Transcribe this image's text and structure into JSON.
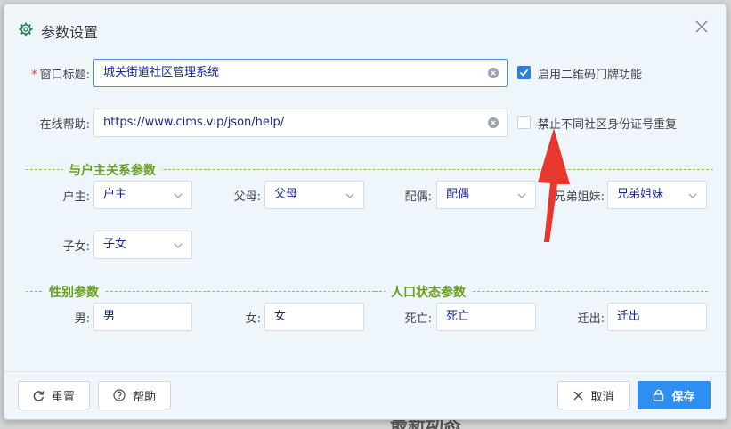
{
  "dialog": {
    "title": "参数设置",
    "window_title": {
      "label": "窗口标题:",
      "value": "城关街道社区管理系统"
    },
    "help": {
      "label": "在线帮助:",
      "value": "https://www.cims.vip/json/help/"
    },
    "options": [
      {
        "label": "启用二维码门牌功能",
        "checked": true
      },
      {
        "label": "禁止不同社区身份证号重复",
        "checked": false
      }
    ],
    "sections": {
      "relation": "与户主关系参数",
      "gender": "性别参数",
      "status": "人口状态参数"
    },
    "relation_fields": [
      {
        "label": "户主:",
        "value": "户主"
      },
      {
        "label": "父母:",
        "value": "父母"
      },
      {
        "label": "配偶:",
        "value": "配偶"
      },
      {
        "label": "兄弟姐妹:",
        "value": "兄弟姐妹"
      },
      {
        "label": "子女:",
        "value": "子女"
      }
    ],
    "gender_fields": [
      {
        "label": "男:",
        "value": "男"
      },
      {
        "label": "女:",
        "value": "女"
      }
    ],
    "status_fields": [
      {
        "label": "死亡:",
        "value": "死亡"
      },
      {
        "label": "迁出:",
        "value": "迁出"
      }
    ],
    "buttons": {
      "reset": "重置",
      "help": "帮助",
      "cancel": "取消",
      "save": "保存"
    }
  },
  "background": {
    "bottom_text": "最新动态"
  },
  "colors": {
    "primary": "#2f8ff0",
    "section": "#6a9f1e",
    "arrow": "#e8382e"
  }
}
